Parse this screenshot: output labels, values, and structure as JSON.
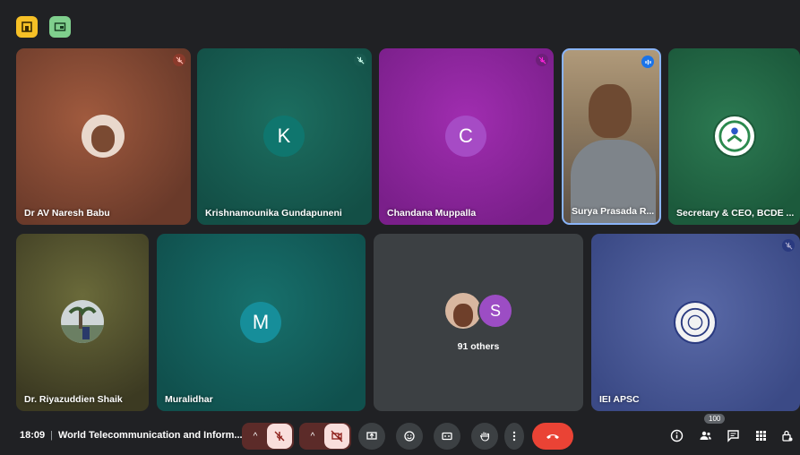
{
  "tiles": [
    {
      "name": "Dr AV Naresh Babu",
      "muted": true
    },
    {
      "name": "Krishnamounika Gundapuneni",
      "initial": "K",
      "muted": true
    },
    {
      "name": "Chandana Muppalla",
      "initial": "C",
      "muted": true
    },
    {
      "name": "Surya Prasada R...",
      "speaking": true
    },
    {
      "name": "Secretary & CEO, BCDE ..."
    },
    {
      "name": "Dr. Riyazuddien Shaik"
    },
    {
      "name": "Muralidhar",
      "initial": "M"
    },
    {
      "name": "91 others",
      "initial": "S"
    },
    {
      "name": "IEI APSC",
      "muted": true
    }
  ],
  "colors": {
    "avatar_k": "#0f766e",
    "avatar_c": "#a64bc5",
    "avatar_m": "#168e9a",
    "avatar_s": "#9c4dc4",
    "hangup": "#ea4335",
    "speaking_border": "#8ab4f8"
  },
  "bottom": {
    "time": "18:09",
    "separator": "|",
    "meeting_title": "World Telecommunication and Inform...",
    "participants_count": "100"
  },
  "icons": [
    "layout-icon",
    "present-icon",
    "mic-off-icon",
    "camera-off-icon",
    "present-screen-icon",
    "emoji-icon",
    "captions-icon",
    "raise-hand-icon",
    "more-icon",
    "hangup-icon",
    "info-icon",
    "people-icon",
    "chat-icon",
    "activities-icon",
    "host-controls-icon"
  ]
}
